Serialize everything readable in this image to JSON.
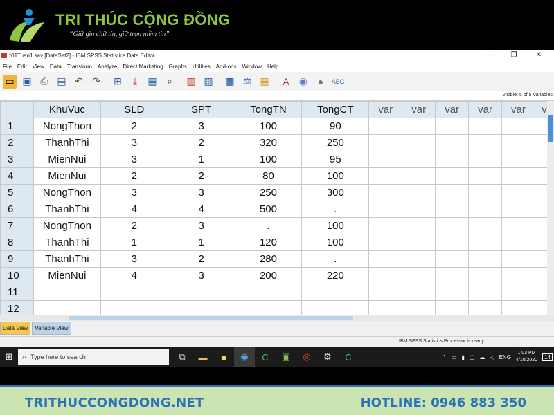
{
  "brand": {
    "title": "TRI THÚC CỘNG ĐỒNG",
    "slogan": "“Giữ gìn chữ tín, giữ trọn niềm tin”",
    "accent": "#8cc63e"
  },
  "window": {
    "title": "*01Tuan1.sav [DataSet2] - IBM SPSS Statistics Data Editor",
    "controls": [
      "—",
      "❐",
      "✕"
    ]
  },
  "menu": [
    "File",
    "Edit",
    "View",
    "Data",
    "Transform",
    "Analyze",
    "Direct Marketing",
    "Graphs",
    "Utilities",
    "Add-ons",
    "Window",
    "Help"
  ],
  "toolbar_icons": [
    "open-icon",
    "save-icon",
    "print-icon",
    "dialog-recall-icon",
    "undo-icon",
    "redo-icon",
    "goto-case-icon",
    "goto-variable-icon",
    "variables-icon",
    "find-icon",
    "insert-cases-icon",
    "insert-variable-icon",
    "split-file-icon",
    "weight-cases-icon",
    "select-cases-icon",
    "value-labels-icon",
    "use-sets-icon",
    "show-all-icon",
    "spell-check-icon"
  ],
  "visible_info": "Visible: 5 of 5 Variables",
  "grid": {
    "columns": [
      "KhuVuc",
      "SLD",
      "SPT",
      "TongTN",
      "TongCT",
      "var",
      "var",
      "var",
      "var",
      "var",
      "v"
    ],
    "rows": [
      {
        "n": "1",
        "cells": [
          "NongThon",
          "2",
          "3",
          "100",
          "90"
        ]
      },
      {
        "n": "2",
        "cells": [
          "ThanhThi",
          "3",
          "2",
          "320",
          "250"
        ]
      },
      {
        "n": "3",
        "cells": [
          "MienNui",
          "3",
          "1",
          "100",
          "95"
        ]
      },
      {
        "n": "4",
        "cells": [
          "MienNui",
          "2",
          "2",
          "80",
          "100"
        ]
      },
      {
        "n": "5",
        "cells": [
          "NongThon",
          "3",
          "3",
          "250",
          "300"
        ]
      },
      {
        "n": "6",
        "cells": [
          "ThanhThi",
          "4",
          "4",
          "500",
          "."
        ]
      },
      {
        "n": "7",
        "cells": [
          "NongThon",
          "2",
          "3",
          ".",
          "100"
        ]
      },
      {
        "n": "8",
        "cells": [
          "ThanhThi",
          "1",
          "1",
          "120",
          "100"
        ]
      },
      {
        "n": "9",
        "cells": [
          "ThanhThi",
          "3",
          "2",
          "280",
          "."
        ]
      },
      {
        "n": "10",
        "cells": [
          "MienNui",
          "4",
          "3",
          "200",
          "220"
        ]
      },
      {
        "n": "11",
        "cells": [
          "",
          "",
          "",
          "",
          ""
        ]
      },
      {
        "n": "12",
        "cells": [
          "",
          "",
          "",
          "",
          ""
        ]
      }
    ]
  },
  "tabs": {
    "data_view": "Data View",
    "variable_view": "Variable View"
  },
  "status": "IBM SPSS Statistics Processor is ready",
  "taskbar": {
    "search_placeholder": "Type here to search",
    "lang": "ENG",
    "time": "1:03 PM",
    "date": "4/10/2020",
    "notifications": "14"
  },
  "footer": {
    "site": "TRITHUCCONGDONG.NET",
    "hotline": "HOTLINE: 0946 883 350"
  }
}
